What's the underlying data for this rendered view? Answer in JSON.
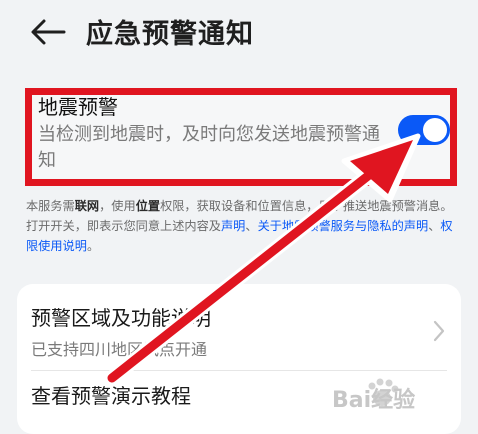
{
  "header": {
    "title": "应急预警通知"
  },
  "earthquake": {
    "title": "地震预警",
    "description": "当检测到地震时，及时向您发送地震预警通知",
    "enabled": true
  },
  "notice": {
    "p1": "本服务需",
    "b1": "联网",
    "p2": "，使用",
    "b2": "位置",
    "p3": "权限，获取设备和位置信息，用于推送地震预警消息。打开开关，即表示您同意上述内容及",
    "link1": "声明",
    "sep1": "、",
    "link2": "关于地震预警服务与隐私的声明",
    "sep2": "、",
    "link3": "权限使用说明",
    "end": "。"
  },
  "list": {
    "items": [
      {
        "title": "预警区域及功能说明",
        "subtitle": "已支持四川地区试点开通"
      },
      {
        "title": "查看预警演示教程"
      }
    ]
  },
  "watermark": {
    "text": "Bai经验"
  },
  "colors": {
    "accent": "#0a59f7",
    "annotation": "#e01520"
  }
}
